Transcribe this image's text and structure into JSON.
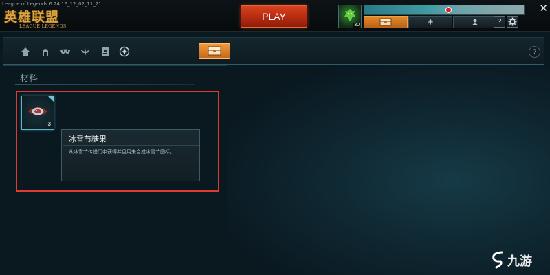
{
  "window": {
    "version": "League of Legends 6.24.16_12_02_11_21",
    "close_glyph": "✕"
  },
  "logo": {
    "cn": "英雄联盟",
    "en": "LEAGUE·LEGENDS"
  },
  "header": {
    "play_label": "PLAY",
    "summoner_level": "30",
    "help_label": "?",
    "settings_icon": "gear-icon",
    "nav_tabs": [
      {
        "name": "store",
        "icon": "chest-icon"
      },
      {
        "name": "champions",
        "icon": "champion-icon"
      },
      {
        "name": "profile",
        "icon": "profile-icon"
      }
    ]
  },
  "subnav": {
    "icons": [
      "home-icon",
      "champion-helmet-icon",
      "mask-icon",
      "winged-icon",
      "profile-card-icon",
      "crafting-icon"
    ],
    "chest_icon": "chest-icon",
    "help_label": "?"
  },
  "section": {
    "title": "材料"
  },
  "item": {
    "count": "3",
    "name": "冰雪节糖果",
    "description": "从冰雪节传送门中获得并且用来合成冰雪节图标。"
  },
  "watermark": {
    "text": "九游"
  },
  "colors": {
    "play": "#c2331a",
    "store_tab": "#e08a2c",
    "highlight": "#e03a33",
    "item_border": "#5db6c4"
  }
}
